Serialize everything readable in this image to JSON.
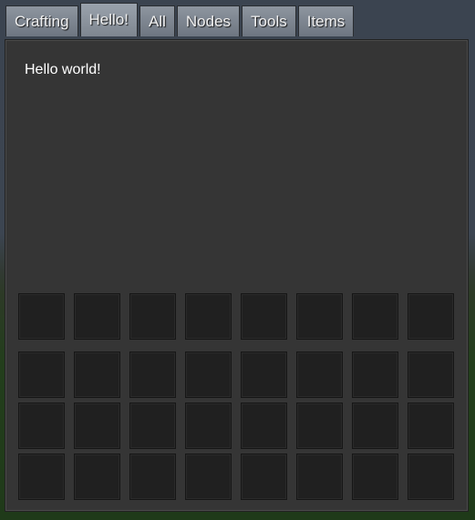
{
  "tabs": [
    {
      "label": "Crafting",
      "active": false
    },
    {
      "label": "Hello!",
      "active": true
    },
    {
      "label": "All",
      "active": false
    },
    {
      "label": "Nodes",
      "active": false
    },
    {
      "label": "Tools",
      "active": false
    },
    {
      "label": "Items",
      "active": false
    }
  ],
  "panel": {
    "text": "Hello world!"
  },
  "inventory": {
    "hotbar_slots": 8,
    "main_rows": 3,
    "columns": 8
  },
  "colors": {
    "panel_bg": "#353535",
    "slot_bg": "#202020",
    "tab_bg": "#7e8690"
  }
}
